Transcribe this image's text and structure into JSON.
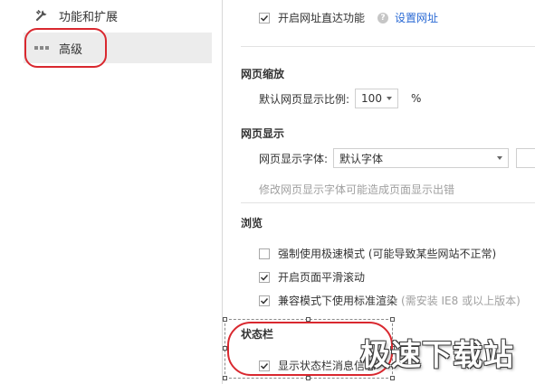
{
  "sidebar": {
    "items": [
      {
        "label": "功能和扩展",
        "icon": "wrench-icon"
      },
      {
        "label": "高级",
        "icon": "dots-icon",
        "active": true
      }
    ]
  },
  "main": {
    "direct_url": {
      "label": "开启网址直达功能",
      "checked": true,
      "link": "设置网址"
    },
    "zoom": {
      "title": "网页缩放",
      "label": "默认网页显示比例:",
      "value": "100",
      "unit": "%"
    },
    "display": {
      "title": "网页显示",
      "font_label": "网页显示字体:",
      "font_value": "默认字体",
      "hint": "修改网页显示字体可能造成页面显示出错"
    },
    "browse": {
      "title": "浏览",
      "options": [
        {
          "label": "强制使用极速模式 (可能导致某些网站不正常)",
          "checked": false,
          "note": ""
        },
        {
          "label": "开启页面平滑滚动",
          "checked": true,
          "note": ""
        },
        {
          "label": "兼容模式下使用标准渲染",
          "checked": true,
          "note": "(需安装 IE8 或以上版本)"
        }
      ]
    },
    "statusbar": {
      "title": "状态栏",
      "option": {
        "label": "显示状态栏消息信息",
        "checked": true
      }
    }
  },
  "watermark": "极速下载站",
  "colors": {
    "annotation_red": "#d9282f",
    "link_blue": "#2a6ad4"
  }
}
